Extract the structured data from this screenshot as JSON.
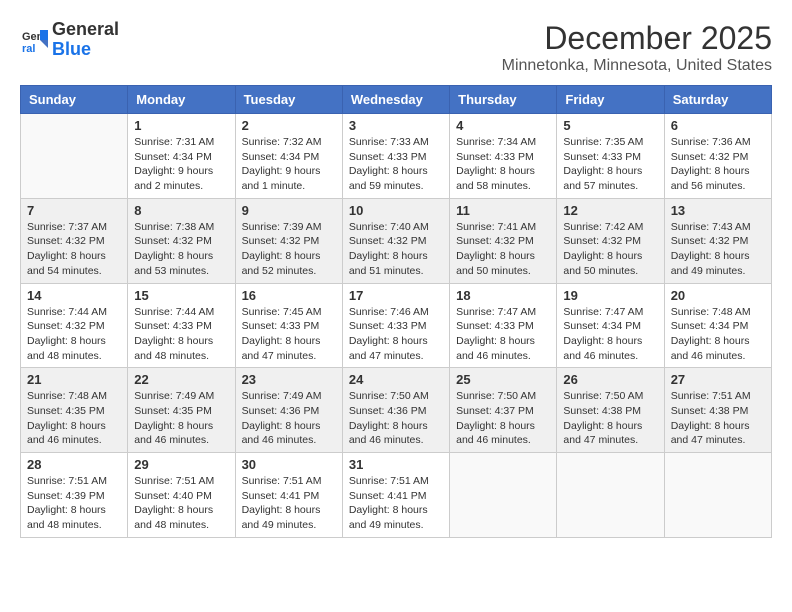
{
  "header": {
    "logo_line1": "General",
    "logo_line2": "Blue",
    "month": "December 2025",
    "location": "Minnetonka, Minnesota, United States"
  },
  "days_of_week": [
    "Sunday",
    "Monday",
    "Tuesday",
    "Wednesday",
    "Thursday",
    "Friday",
    "Saturday"
  ],
  "weeks": [
    [
      {
        "day": "",
        "info": ""
      },
      {
        "day": "1",
        "info": "Sunrise: 7:31 AM\nSunset: 4:34 PM\nDaylight: 9 hours\nand 2 minutes."
      },
      {
        "day": "2",
        "info": "Sunrise: 7:32 AM\nSunset: 4:34 PM\nDaylight: 9 hours\nand 1 minute."
      },
      {
        "day": "3",
        "info": "Sunrise: 7:33 AM\nSunset: 4:33 PM\nDaylight: 8 hours\nand 59 minutes."
      },
      {
        "day": "4",
        "info": "Sunrise: 7:34 AM\nSunset: 4:33 PM\nDaylight: 8 hours\nand 58 minutes."
      },
      {
        "day": "5",
        "info": "Sunrise: 7:35 AM\nSunset: 4:33 PM\nDaylight: 8 hours\nand 57 minutes."
      },
      {
        "day": "6",
        "info": "Sunrise: 7:36 AM\nSunset: 4:32 PM\nDaylight: 8 hours\nand 56 minutes."
      }
    ],
    [
      {
        "day": "7",
        "info": "Sunrise: 7:37 AM\nSunset: 4:32 PM\nDaylight: 8 hours\nand 54 minutes."
      },
      {
        "day": "8",
        "info": "Sunrise: 7:38 AM\nSunset: 4:32 PM\nDaylight: 8 hours\nand 53 minutes."
      },
      {
        "day": "9",
        "info": "Sunrise: 7:39 AM\nSunset: 4:32 PM\nDaylight: 8 hours\nand 52 minutes."
      },
      {
        "day": "10",
        "info": "Sunrise: 7:40 AM\nSunset: 4:32 PM\nDaylight: 8 hours\nand 51 minutes."
      },
      {
        "day": "11",
        "info": "Sunrise: 7:41 AM\nSunset: 4:32 PM\nDaylight: 8 hours\nand 50 minutes."
      },
      {
        "day": "12",
        "info": "Sunrise: 7:42 AM\nSunset: 4:32 PM\nDaylight: 8 hours\nand 50 minutes."
      },
      {
        "day": "13",
        "info": "Sunrise: 7:43 AM\nSunset: 4:32 PM\nDaylight: 8 hours\nand 49 minutes."
      }
    ],
    [
      {
        "day": "14",
        "info": "Sunrise: 7:44 AM\nSunset: 4:32 PM\nDaylight: 8 hours\nand 48 minutes."
      },
      {
        "day": "15",
        "info": "Sunrise: 7:44 AM\nSunset: 4:33 PM\nDaylight: 8 hours\nand 48 minutes."
      },
      {
        "day": "16",
        "info": "Sunrise: 7:45 AM\nSunset: 4:33 PM\nDaylight: 8 hours\nand 47 minutes."
      },
      {
        "day": "17",
        "info": "Sunrise: 7:46 AM\nSunset: 4:33 PM\nDaylight: 8 hours\nand 47 minutes."
      },
      {
        "day": "18",
        "info": "Sunrise: 7:47 AM\nSunset: 4:33 PM\nDaylight: 8 hours\nand 46 minutes."
      },
      {
        "day": "19",
        "info": "Sunrise: 7:47 AM\nSunset: 4:34 PM\nDaylight: 8 hours\nand 46 minutes."
      },
      {
        "day": "20",
        "info": "Sunrise: 7:48 AM\nSunset: 4:34 PM\nDaylight: 8 hours\nand 46 minutes."
      }
    ],
    [
      {
        "day": "21",
        "info": "Sunrise: 7:48 AM\nSunset: 4:35 PM\nDaylight: 8 hours\nand 46 minutes."
      },
      {
        "day": "22",
        "info": "Sunrise: 7:49 AM\nSunset: 4:35 PM\nDaylight: 8 hours\nand 46 minutes."
      },
      {
        "day": "23",
        "info": "Sunrise: 7:49 AM\nSunset: 4:36 PM\nDaylight: 8 hours\nand 46 minutes."
      },
      {
        "day": "24",
        "info": "Sunrise: 7:50 AM\nSunset: 4:36 PM\nDaylight: 8 hours\nand 46 minutes."
      },
      {
        "day": "25",
        "info": "Sunrise: 7:50 AM\nSunset: 4:37 PM\nDaylight: 8 hours\nand 46 minutes."
      },
      {
        "day": "26",
        "info": "Sunrise: 7:50 AM\nSunset: 4:38 PM\nDaylight: 8 hours\nand 47 minutes."
      },
      {
        "day": "27",
        "info": "Sunrise: 7:51 AM\nSunset: 4:38 PM\nDaylight: 8 hours\nand 47 minutes."
      }
    ],
    [
      {
        "day": "28",
        "info": "Sunrise: 7:51 AM\nSunset: 4:39 PM\nDaylight: 8 hours\nand 48 minutes."
      },
      {
        "day": "29",
        "info": "Sunrise: 7:51 AM\nSunset: 4:40 PM\nDaylight: 8 hours\nand 48 minutes."
      },
      {
        "day": "30",
        "info": "Sunrise: 7:51 AM\nSunset: 4:41 PM\nDaylight: 8 hours\nand 49 minutes."
      },
      {
        "day": "31",
        "info": "Sunrise: 7:51 AM\nSunset: 4:41 PM\nDaylight: 8 hours\nand 49 minutes."
      },
      {
        "day": "",
        "info": ""
      },
      {
        "day": "",
        "info": ""
      },
      {
        "day": "",
        "info": ""
      }
    ]
  ]
}
